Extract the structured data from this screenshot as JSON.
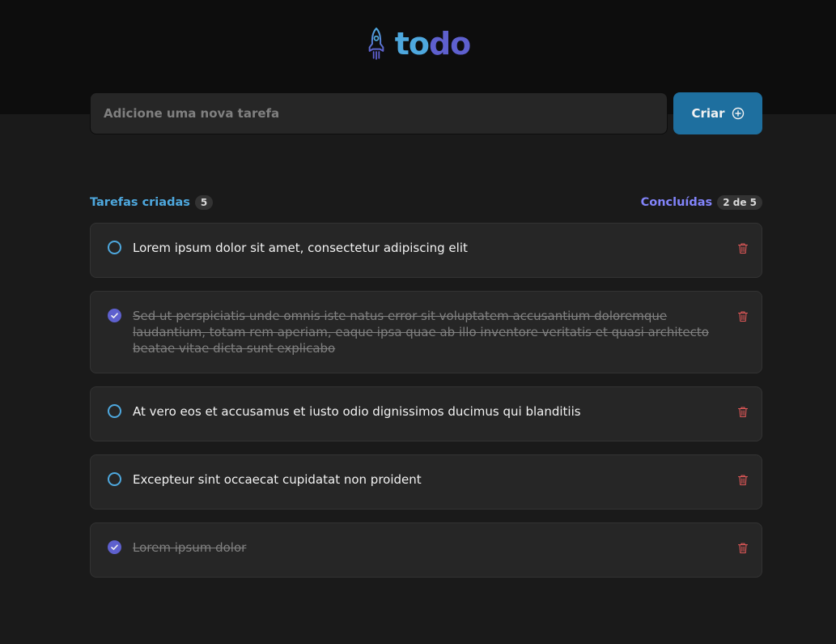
{
  "header": {
    "logo_to": "to",
    "logo_do": "do",
    "logo_icon": "rocket-icon"
  },
  "new_task": {
    "placeholder": "Adicione uma nova tarefa",
    "value": "",
    "create_label": "Criar",
    "create_icon": "plus-circle-icon"
  },
  "counters": {
    "created_label": "Tarefas criadas",
    "created_count": "5",
    "done_label": "Concluídas",
    "done_count": "2 de 5"
  },
  "tasks": [
    {
      "text": "Lorem ipsum dolor sit amet, consectetur adipiscing elit",
      "completed": false
    },
    {
      "text": "Sed ut perspiciatis unde omnis iste natus error sit voluptatem accusantium doloremque laudantium, totam rem aperiam, eaque ipsa quae ab illo inventore veritatis et quasi architecto beatae vitae dicta sunt explicabo",
      "completed": true
    },
    {
      "text": "At vero eos et accusamus et iusto odio dignissimos ducimus qui blanditiis",
      "completed": false
    },
    {
      "text": "Excepteur sint occaecat cupidatat non proident",
      "completed": false
    },
    {
      "text": "Lorem ipsum dolor",
      "completed": true
    }
  ],
  "colors": {
    "blue": "#4ea8de",
    "purple": "#5e60ce",
    "purple_light": "#8284fa",
    "danger": "#e25858",
    "button": "#1e6f9f"
  }
}
